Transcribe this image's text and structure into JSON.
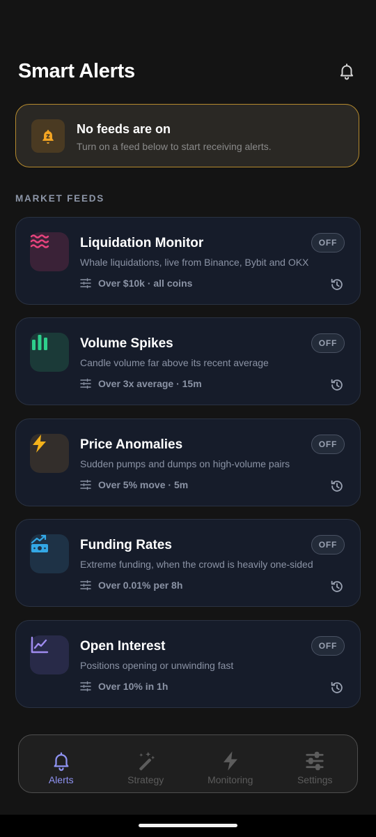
{
  "header": {
    "title": "Smart Alerts",
    "bell_icon": "bell-icon"
  },
  "banner": {
    "icon": "snooze-bell-icon",
    "title": "No feeds are on",
    "subtitle": "Turn on a feed below to start receiving alerts."
  },
  "section_label": "MARKET FEEDS",
  "feeds": [
    {
      "name": "Liquidation Monitor",
      "description": "Whale liquidations, live from Binance, Bybit and OKX",
      "meta": "Over $10k · all coins",
      "toggle": "OFF",
      "icon": "waves-icon",
      "accent": "#e8447e",
      "icon_bg": "#3a2237"
    },
    {
      "name": "Volume Spikes",
      "description": "Candle volume far above its recent average",
      "meta": "Over 3x average · 15m",
      "toggle": "OFF",
      "icon": "bar-chart-icon",
      "accent": "#2ecf8c",
      "icon_bg": "#1b3a38"
    },
    {
      "name": "Price Anomalies",
      "description": "Sudden pumps and dumps on high-volume pairs",
      "meta": "Over 5% move · 5m",
      "toggle": "OFF",
      "icon": "lightning-icon",
      "accent": "#f5b21a",
      "icon_bg": "#332e2b"
    },
    {
      "name": "Funding Rates",
      "description": "Extreme funding, when the crowd is heavily one-sided",
      "meta": "Over 0.01% per 8h",
      "toggle": "OFF",
      "icon": "money-trend-icon",
      "accent": "#33a8e6",
      "icon_bg": "#1e3246"
    },
    {
      "name": "Open Interest",
      "description": "Positions opening or unwinding fast",
      "meta": "Over 10% in 1h",
      "toggle": "OFF",
      "icon": "line-chart-icon",
      "accent": "#a08cf0",
      "icon_bg": "#282a48"
    }
  ],
  "nav": [
    {
      "label": "Alerts",
      "icon": "bell-icon",
      "active": true
    },
    {
      "label": "Strategy",
      "icon": "magic-wand-icon",
      "active": false
    },
    {
      "label": "Monitoring",
      "icon": "lightning-icon",
      "active": false
    },
    {
      "label": "Settings",
      "icon": "sliders-icon",
      "active": false
    }
  ],
  "colors": {
    "accent_active": "#8f93f2",
    "banner_border": "#b58a2e",
    "background": "#141414"
  }
}
